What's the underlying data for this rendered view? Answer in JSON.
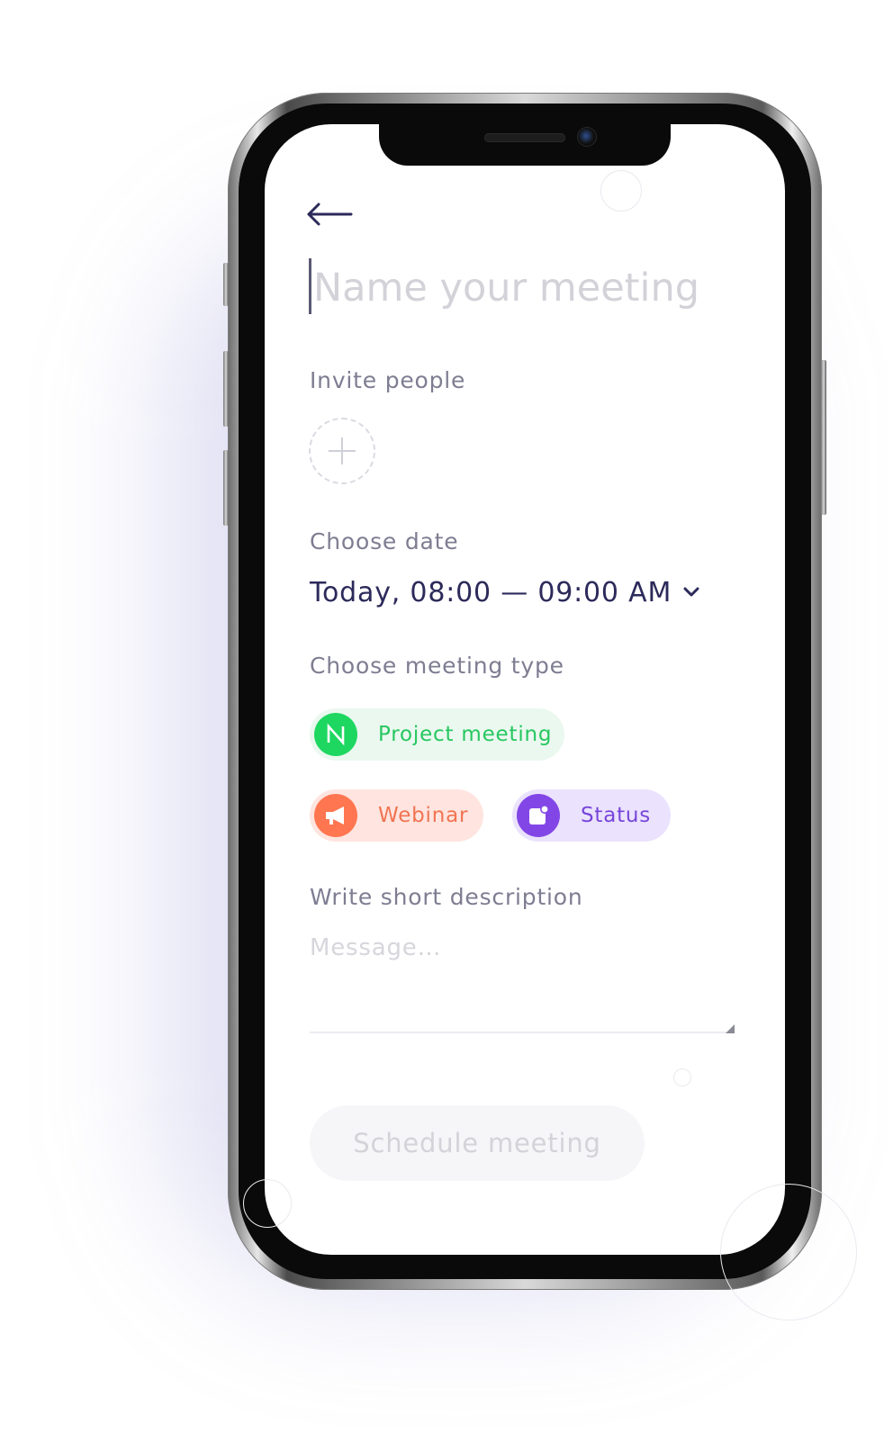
{
  "app": {
    "title_placeholder": "Name your meeting",
    "back_icon": "arrow-left-icon"
  },
  "invite": {
    "label": "Invite people",
    "add_icon": "plus-icon"
  },
  "date": {
    "label": "Choose date",
    "value": "Today, 08:00 — 09:00 AM",
    "dropdown_icon": "chevron-down-icon"
  },
  "meeting_type": {
    "label": "Choose meeting type",
    "options": [
      {
        "label": "Project meeting",
        "icon": "project-icon",
        "color": "#1ED760"
      },
      {
        "label": "Webinar",
        "icon": "megaphone-icon",
        "color": "#FF7650"
      },
      {
        "label": "Status",
        "icon": "status-icon",
        "color": "#8346E6"
      }
    ]
  },
  "description": {
    "label": "Write short description",
    "placeholder": "Message…"
  },
  "schedule": {
    "label": "Schedule meeting"
  },
  "colors": {
    "primary_text": "#2C2A5A",
    "secondary_text": "#7E7D92",
    "placeholder_text": "#D2D2D8"
  }
}
